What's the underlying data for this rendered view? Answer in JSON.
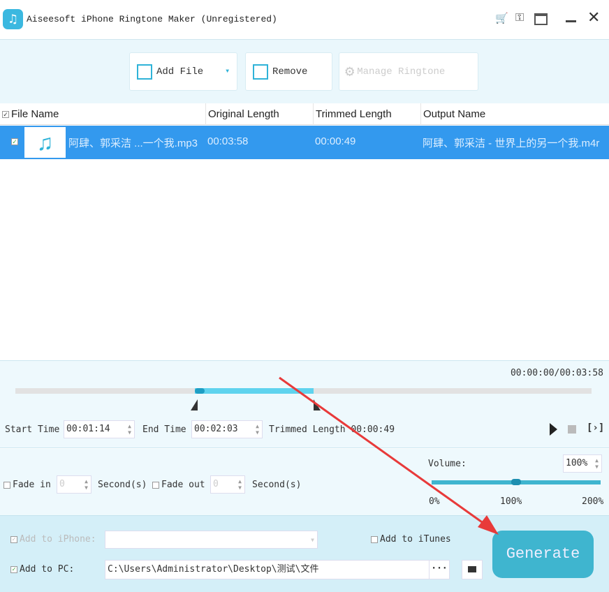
{
  "window": {
    "title": "Aiseesoft iPhone Ringtone Maker (Unregistered)"
  },
  "toolbar": {
    "add_file": "Add File",
    "remove": "Remove",
    "manage_ringtone": "Manage Ringtone"
  },
  "table": {
    "columns": [
      "File Name",
      "Original Length",
      "Trimmed Length",
      "Output Name"
    ],
    "rows": [
      {
        "checked": true,
        "file_name": "阿肆、郭采洁 ...一个我.mp3",
        "original_length": "00:03:58",
        "trimmed_length": "00:00:49",
        "output_name": "阿肆、郭采洁 - 世界上的另一个我.m4r"
      }
    ]
  },
  "player": {
    "time_readout": "00:00:00/00:03:58",
    "trim_start_fraction": 0.311,
    "trim_end_fraction": 0.517
  },
  "trim": {
    "start_label": "Start Time",
    "start_value": "00:01:14",
    "end_label": "End Time",
    "end_value": "00:02:03",
    "trimmed_label": "Trimmed Length",
    "trimmed_value": "00:00:49"
  },
  "fade": {
    "fade_in_label": "Fade in",
    "fade_in_value": "0",
    "fade_out_label": "Fade out",
    "fade_out_value": "0",
    "unit": "Second(s)"
  },
  "volume": {
    "label": "Volume:",
    "value": "100%",
    "ticks": [
      "0%",
      "100%",
      "200%"
    ],
    "fraction": 0.5
  },
  "output": {
    "add_iphone": "Add to iPhone:",
    "add_itunes": "Add to iTunes",
    "add_pc": "Add to PC:",
    "pc_path": "C:\\Users\\Administrator\\Desktop\\测试\\文件",
    "browse": "···",
    "generate": "Generate"
  },
  "colors": {
    "accent": "#2fb3d8",
    "selected_row": "#3399ee",
    "generate": "#3fb5cf",
    "arrow": "#e83a3a"
  }
}
